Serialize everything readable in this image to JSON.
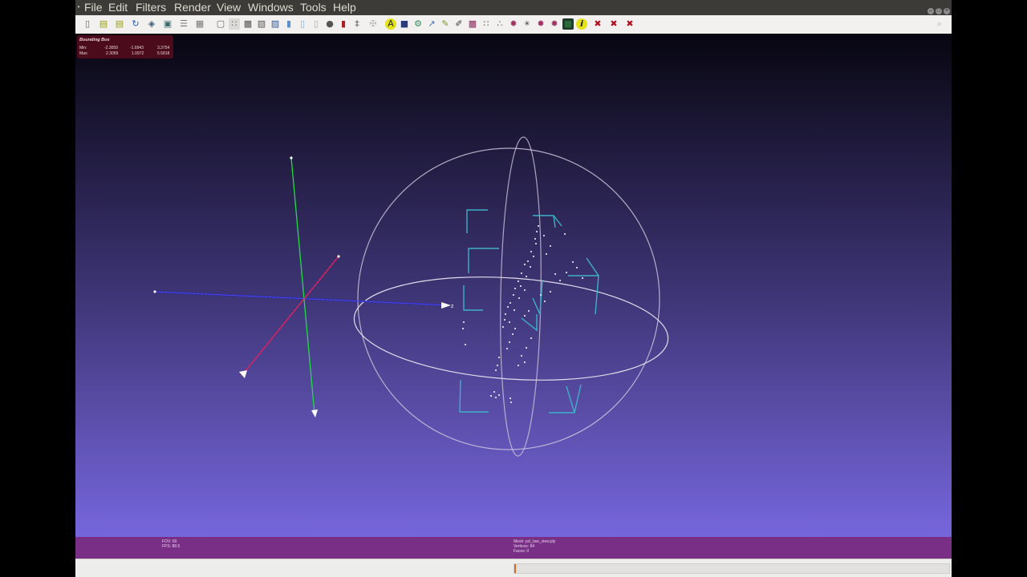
{
  "menubar": {
    "items": [
      "File",
      "Edit",
      "Filters",
      "Render",
      "View",
      "Windows",
      "Tools",
      "Help"
    ]
  },
  "bounding_box": {
    "title": "Bounding Box",
    "min_label": "Min:",
    "max_label": "Max:",
    "min": [
      "-2.3059",
      "-1.6943",
      "3.3754"
    ],
    "max": [
      "2.3059",
      "1.0972",
      "5.5818"
    ]
  },
  "axes": {
    "z_label": "z",
    "colors": {
      "x": "#cc1155",
      "y": "#22dd44",
      "z": "#1a1acc"
    }
  },
  "status_left": {
    "fov": "FOV: 60",
    "fps": "FPS:   88.5"
  },
  "status_center": {
    "mesh": "Mesh: pcl_two_view.ply",
    "vertices": "Vertices: 84",
    "faces": "Faces: 0"
  },
  "progress": {
    "value": 0.003
  },
  "colors": {
    "menubar": "#3c3b37",
    "toolbar": "#f2f1f0",
    "info_bar": "#7a2f86",
    "bbox_panel": "#4b0b1b",
    "camera_frusta": "#3fb0c8",
    "trackball": "#d0d0d0"
  },
  "toolbar_icons": [
    "new-icon",
    "open-icon",
    "open-project-icon",
    "reload-icon",
    "save-icon",
    "snapshot-icon",
    "layers-icon",
    "close-icon",
    "bbox-icon",
    "points-icon",
    "wireframe-icon",
    "hidden-lines-icon",
    "flat-icon",
    "smooth-icon",
    "texture-icon",
    "select-icon",
    "light-icon",
    "color-icon",
    "normals-icon",
    "annotate-icon",
    "align-icon",
    "measure-icon",
    "pick-points-icon",
    "paint-icon",
    "camera-icon",
    "edit-icon",
    "mesh-select-icon",
    "vertex-select-icon",
    "face-select-icon",
    "move-icon",
    "compass-icon",
    "info-icon",
    "delete-faces-icon",
    "delete-vertices-icon",
    "delete-all-icon"
  ]
}
